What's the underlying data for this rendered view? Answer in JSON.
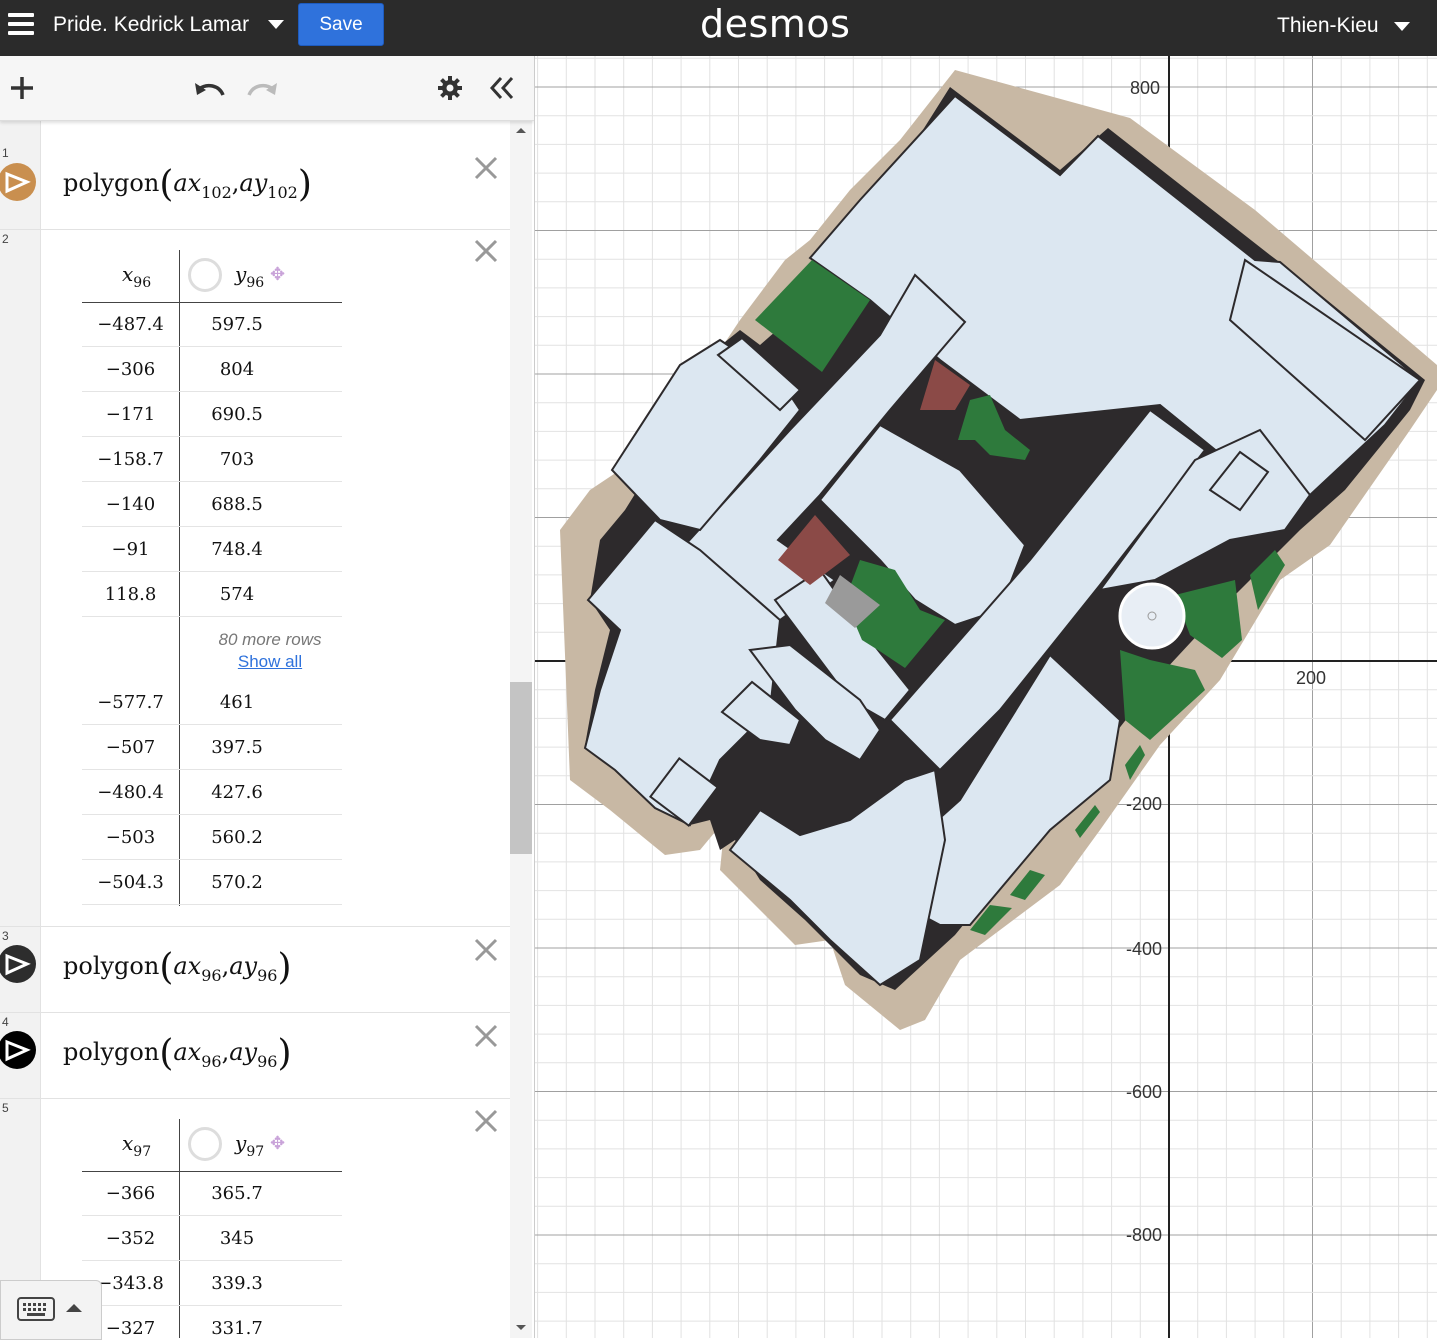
{
  "header": {
    "title": "Pride. Kedrick Lamar",
    "save_label": "Save",
    "logo": "desmos",
    "user": "Thien-Kieu"
  },
  "toolbar": {
    "icons": [
      "add-icon",
      "undo-icon",
      "redo-icon",
      "gear-icon",
      "collapse-icon"
    ]
  },
  "expressions": [
    {
      "num": "1",
      "func": "polygon",
      "arg1": "ax",
      "arg1_sub": "102",
      "arg2": "ay",
      "arg2_sub": "102",
      "color": "#c98f4f"
    },
    {
      "num": "2",
      "x_header": "x",
      "x_sub": "96",
      "y_header": "y",
      "y_sub": "96",
      "rows_top": [
        [
          "−487.4",
          "597.5"
        ],
        [
          "−306",
          "804"
        ],
        [
          "−171",
          "690.5"
        ],
        [
          "−158.7",
          "703"
        ],
        [
          "−140",
          "688.5"
        ],
        [
          "−91",
          "748.4"
        ],
        [
          "118.8",
          "574"
        ]
      ],
      "more_rows": "80 more rows",
      "show_all": "Show all",
      "rows_bottom": [
        [
          "−577.7",
          "461"
        ],
        [
          "−507",
          "397.5"
        ],
        [
          "−480.4",
          "427.6"
        ],
        [
          "−503",
          "560.2"
        ],
        [
          "−504.3",
          "570.2"
        ]
      ]
    },
    {
      "num": "3",
      "func": "polygon",
      "arg1": "ax",
      "arg1_sub": "96",
      "arg2": "ay",
      "arg2_sub": "96",
      "color": "#2d2d2d"
    },
    {
      "num": "4",
      "func": "polygon",
      "arg1": "ax",
      "arg1_sub": "96",
      "arg2": "ay",
      "arg2_sub": "96",
      "color": "#000000"
    },
    {
      "num": "5",
      "x_header": "x",
      "x_sub": "97",
      "y_header": "y",
      "y_sub": "97",
      "rows_top": [
        [
          "−366",
          "365.7"
        ],
        [
          "−352",
          "345"
        ],
        [
          "−343.8",
          "339.3"
        ],
        [
          "−327",
          "331.7"
        ]
      ]
    }
  ],
  "graph": {
    "y_ticks": [
      "800",
      "-200",
      "-400",
      "-600",
      "-800"
    ],
    "x_ticks": [
      "200"
    ],
    "colors": {
      "building": "#dce7f1",
      "outline": "#2d2a2c",
      "ground": "#c8b8a4",
      "grass": "#2e7a3c",
      "brick": "#8b4a47",
      "stone": "#9a9a9a"
    }
  }
}
